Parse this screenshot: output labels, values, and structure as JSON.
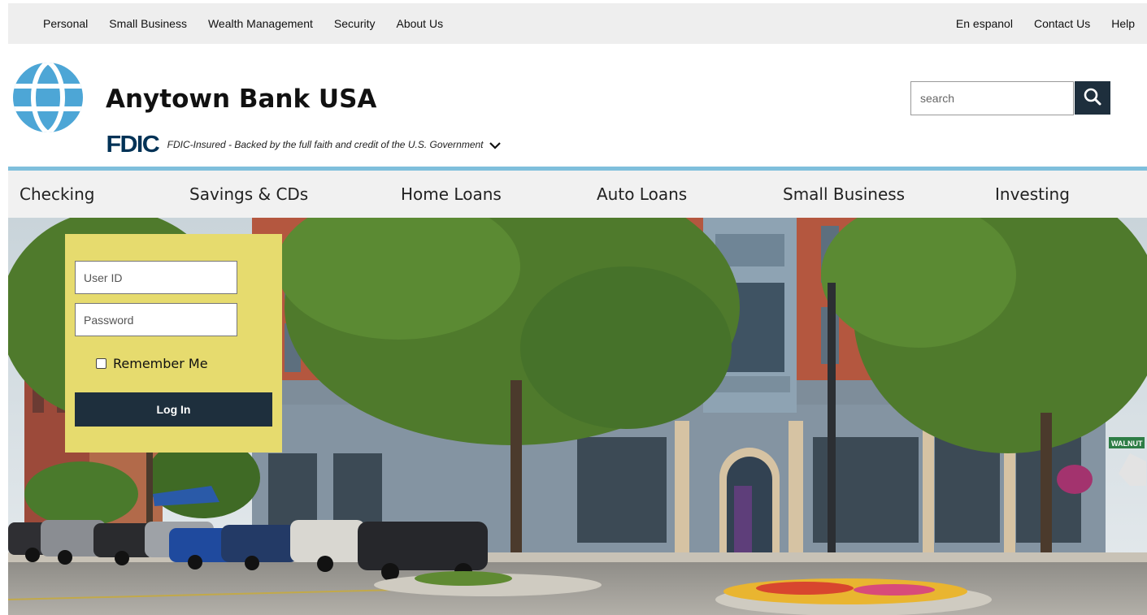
{
  "utility_nav": {
    "left": [
      "Personal",
      "Small Business",
      "Wealth Management",
      "Security",
      "About Us"
    ],
    "right": [
      "En espanol",
      "Contact Us",
      "Help"
    ]
  },
  "header": {
    "bank_name": "Anytown Bank USA",
    "logo_icon": "globe-icon",
    "fdic_logo": "FDIC",
    "fdic_text": "FDIC-Insured - Backed by the full faith and credit of the U.S. Government",
    "fdic_toggle_icon": "chevron-down-icon"
  },
  "search": {
    "placeholder": "search",
    "icon": "search-icon"
  },
  "main_nav": [
    "Checking",
    "Savings & CDs",
    "Home Loans",
    "Auto Loans",
    "Small Business",
    "Investing"
  ],
  "login": {
    "user_id_placeholder": "User ID",
    "password_placeholder": "Password",
    "remember_label": "Remember Me",
    "remember_checked": false,
    "submit_label": "Log In"
  },
  "hero": {
    "street_sign": "WALNUT"
  },
  "colors": {
    "utility_bg": "#eeeeee",
    "accent_rule": "#7fbfdc",
    "nav_bg": "#f1f1f1",
    "button_dark": "#1e2f3d",
    "login_panel": "#e6db6e",
    "fdic_blue": "#003256",
    "globe_blue": "#4da6d6"
  }
}
